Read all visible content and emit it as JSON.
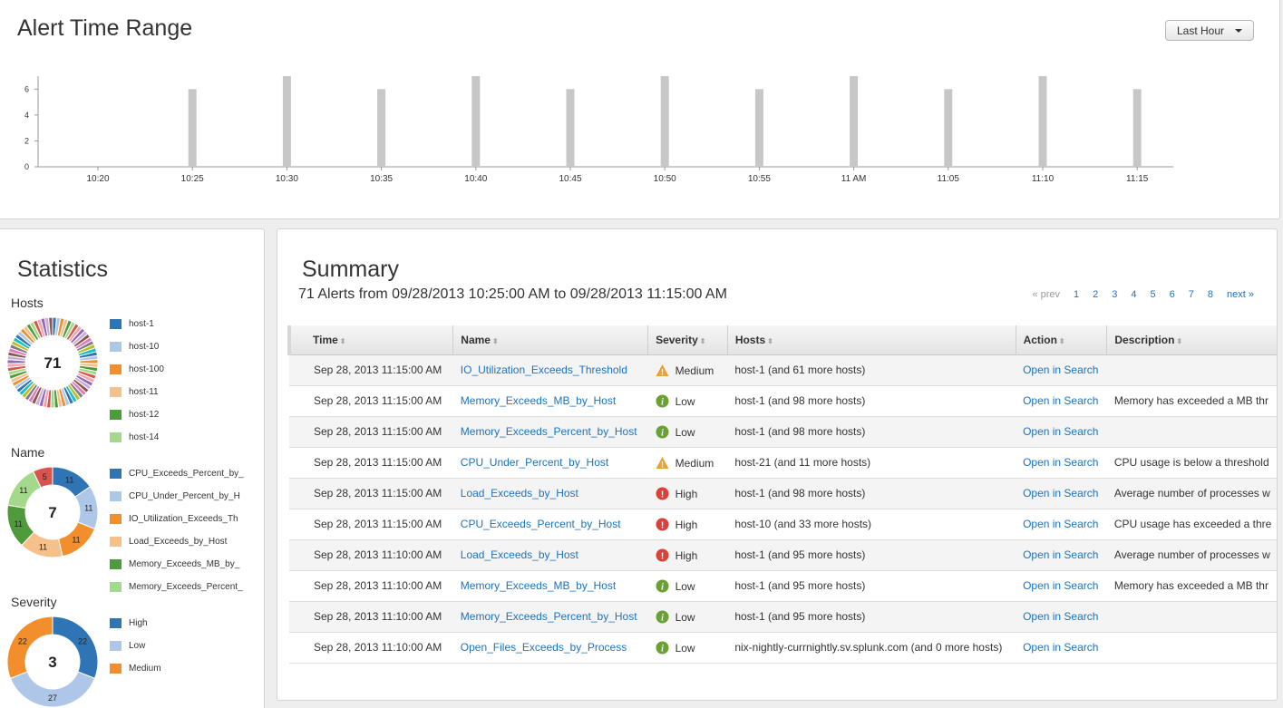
{
  "time_range": {
    "title": "Alert Time Range",
    "range_button": "Last Hour",
    "chart_data": {
      "type": "bar",
      "x": [
        "10:20",
        "10:25",
        "10:30",
        "10:35",
        "10:40",
        "10:45",
        "10:50",
        "10:55",
        "11 AM",
        "11:05",
        "11:10",
        "11:15"
      ],
      "values": [
        0,
        6,
        7,
        6,
        7,
        6,
        7,
        6,
        7,
        6,
        7,
        6
      ],
      "yticks": [
        "0",
        "2",
        "4",
        "6"
      ],
      "ylim": [
        0,
        7
      ],
      "color": "#c7c7c7"
    }
  },
  "statistics": {
    "title": "Statistics",
    "hosts": {
      "label": "Hosts",
      "total": "71",
      "legend": [
        "host-1",
        "host-10",
        "host-100",
        "host-11",
        "host-12",
        "host-14"
      ]
    },
    "name": {
      "label": "Name",
      "total": "7",
      "legend": [
        "CPU_Exceeds_Percent_by_",
        "CPU_Under_Percent_by_H",
        "IO_Utilization_Exceeds_Th",
        "Load_Exceeds_by_Host",
        "Memory_Exceeds_MB_by_",
        "Memory_Exceeds_Percent_"
      ],
      "slices": [
        11,
        11,
        11,
        11,
        11,
        11,
        5
      ],
      "colors": [
        "#2f75b5",
        "#aec7e8",
        "#f28e2b",
        "#f6c08a",
        "#4f9a3a",
        "#a4d88a",
        "#d9534f"
      ]
    },
    "severity": {
      "label": "Severity",
      "total": "3",
      "legend": [
        "High",
        "Low",
        "Medium"
      ],
      "slices": [
        22,
        27,
        22
      ],
      "colors": [
        "#2f75b5",
        "#aec7e8",
        "#f28e2b"
      ]
    }
  },
  "summary": {
    "title": "Summary",
    "subtitle": "71 Alerts from 09/28/2013 10:25:00 AM to 09/28/2013 11:15:00 AM",
    "pager": {
      "prev": "« prev",
      "pages": [
        "1",
        "2",
        "3",
        "4",
        "5",
        "6",
        "7",
        "8"
      ],
      "next": "next »"
    },
    "columns": [
      "Time",
      "Name",
      "Severity",
      "Hosts",
      "Action",
      "Description"
    ],
    "rows": [
      {
        "time": "Sep 28, 2013 11:15:00 AM",
        "name": "IO_Utilization_Exceeds_Threshold",
        "severity": "Medium",
        "hosts": "host-1 (and 61 more hosts)",
        "action": "Open in Search",
        "description": ""
      },
      {
        "time": "Sep 28, 2013 11:15:00 AM",
        "name": "Memory_Exceeds_MB_by_Host",
        "severity": "Low",
        "hosts": "host-1 (and 98 more hosts)",
        "action": "Open in Search",
        "description": "Memory has exceeded a MB thr"
      },
      {
        "time": "Sep 28, 2013 11:15:00 AM",
        "name": "Memory_Exceeds_Percent_by_Host",
        "severity": "Low",
        "hosts": "host-1 (and 98 more hosts)",
        "action": "Open in Search",
        "description": ""
      },
      {
        "time": "Sep 28, 2013 11:15:00 AM",
        "name": "CPU_Under_Percent_by_Host",
        "severity": "Medium",
        "hosts": "host-21 (and 11 more hosts)",
        "action": "Open in Search",
        "description": "CPU usage is below a threshold"
      },
      {
        "time": "Sep 28, 2013 11:15:00 AM",
        "name": "Load_Exceeds_by_Host",
        "severity": "High",
        "hosts": "host-1 (and 98 more hosts)",
        "action": "Open in Search",
        "description": "Average number of processes w"
      },
      {
        "time": "Sep 28, 2013 11:15:00 AM",
        "name": "CPU_Exceeds_Percent_by_Host",
        "severity": "High",
        "hosts": "host-10 (and 33 more hosts)",
        "action": "Open in Search",
        "description": "CPU usage has exceeded a thre"
      },
      {
        "time": "Sep 28, 2013 11:10:00 AM",
        "name": "Load_Exceeds_by_Host",
        "severity": "High",
        "hosts": "host-1 (and 95 more hosts)",
        "action": "Open in Search",
        "description": "Average number of processes w"
      },
      {
        "time": "Sep 28, 2013 11:10:00 AM",
        "name": "Memory_Exceeds_MB_by_Host",
        "severity": "Low",
        "hosts": "host-1 (and 95 more hosts)",
        "action": "Open in Search",
        "description": "Memory has exceeded a MB thr"
      },
      {
        "time": "Sep 28, 2013 11:10:00 AM",
        "name": "Memory_Exceeds_Percent_by_Host",
        "severity": "Low",
        "hosts": "host-1 (and 95 more hosts)",
        "action": "Open in Search",
        "description": ""
      },
      {
        "time": "Sep 28, 2013 11:10:00 AM",
        "name": "Open_Files_Exceeds_by_Process",
        "severity": "Low",
        "hosts": "nix-nightly-currnightly.sv.splunk.com (and 0 more hosts)",
        "action": "Open in Search",
        "description": ""
      }
    ]
  }
}
